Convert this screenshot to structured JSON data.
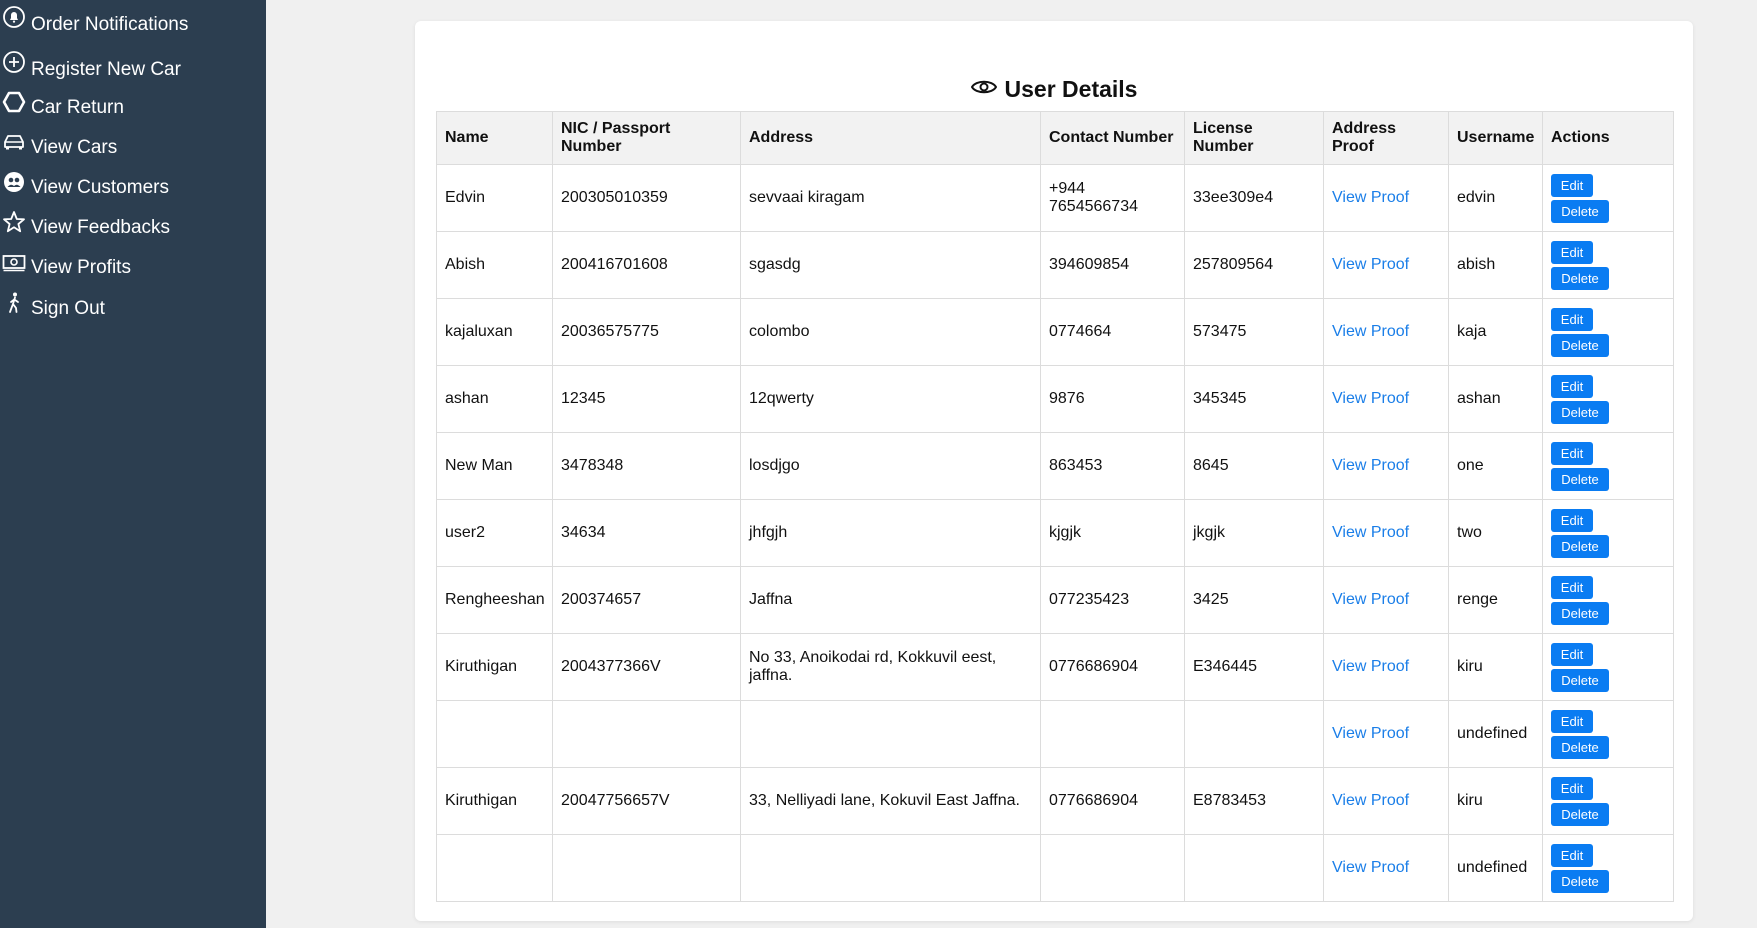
{
  "sidebar": {
    "items": [
      {
        "label": "Order Notifications",
        "icon": "bell-icon"
      },
      {
        "label": "Register New Car",
        "icon": "plus-circle-icon"
      },
      {
        "label": "Car Return",
        "icon": "hexagon-icon"
      },
      {
        "label": "View Cars",
        "icon": "car-icon"
      },
      {
        "label": "View Customers",
        "icon": "customers-icon"
      },
      {
        "label": "View Feedbacks",
        "icon": "star-icon"
      },
      {
        "label": "View Profits",
        "icon": "money-icon"
      },
      {
        "label": "Sign Out",
        "icon": "walking-person-icon"
      }
    ]
  },
  "page": {
    "title": "User Details",
    "title_icon": "eye-icon"
  },
  "table": {
    "headers": [
      "Name",
      "NIC / Passport Number",
      "Address",
      "Contact Number",
      "License Number",
      "Address Proof",
      "Username",
      "Actions"
    ],
    "proof_label": "View Proof",
    "edit_label": "Edit",
    "delete_label": "Delete",
    "rows": [
      {
        "name": "Edvin",
        "nic": "200305010359",
        "address": "sevvaai kiragam",
        "contact": "+944 7654566734",
        "license": "33ee309e4",
        "username": "edvin"
      },
      {
        "name": "Abish",
        "nic": "200416701608",
        "address": "sgasdg",
        "contact": "394609854",
        "license": "257809564",
        "username": "abish"
      },
      {
        "name": "kajaluxan",
        "nic": "20036575775",
        "address": "colombo",
        "contact": "0774664",
        "license": "573475",
        "username": "kaja"
      },
      {
        "name": "ashan",
        "nic": "12345",
        "address": "12qwerty",
        "contact": "9876",
        "license": "345345",
        "username": "ashan"
      },
      {
        "name": "New Man",
        "nic": "3478348",
        "address": "losdjgo",
        "contact": "863453",
        "license": "8645",
        "username": "one"
      },
      {
        "name": "user2",
        "nic": "34634",
        "address": "jhfgjh",
        "contact": "kjgjk",
        "license": "jkgjk",
        "username": "two"
      },
      {
        "name": "Rengheeshan",
        "nic": "200374657",
        "address": "Jaffna",
        "contact": "077235423",
        "license": "3425",
        "username": "renge"
      },
      {
        "name": "Kiruthigan",
        "nic": "2004377366V",
        "address": "No 33, Anoikodai rd, Kokkuvil eest, jaffna.",
        "contact": "0776686904",
        "license": "E346445",
        "username": "kiru"
      },
      {
        "name": "",
        "nic": "",
        "address": "",
        "contact": "",
        "license": "",
        "username": "undefined"
      },
      {
        "name": "Kiruthigan",
        "nic": "20047756657V",
        "address": "33, Nelliyadi lane, Kokuvil East Jaffna.",
        "contact": "0776686904",
        "license": "E8783453",
        "username": "kiru"
      },
      {
        "name": "",
        "nic": "",
        "address": "",
        "contact": "",
        "license": "",
        "username": "undefined"
      }
    ]
  },
  "colors": {
    "sidebar_bg": "#2c3e50",
    "link": "#1a7ee8",
    "button": "#0a7cf2"
  }
}
